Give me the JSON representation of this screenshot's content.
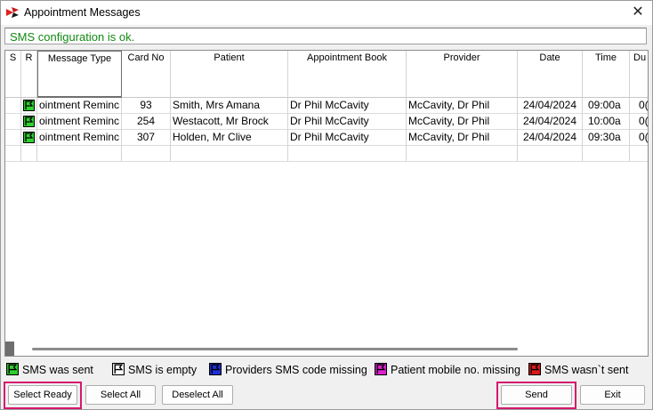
{
  "window": {
    "title": "Appointment Messages",
    "close_glyph": "✕"
  },
  "status": {
    "text": "SMS configuration is ok.",
    "color": "#138a13"
  },
  "grid": {
    "columns": [
      "S",
      "R",
      "Message Type",
      "Card No",
      "Patient",
      "Appointment Book",
      "Provider",
      "Date",
      "Time",
      "Du"
    ],
    "rows": [
      {
        "flag": "green",
        "message_type": "ointment Reminc",
        "card_no": "93",
        "patient": "Smith, Mrs Amana",
        "appointment_book": "Dr Phil McCavity",
        "provider": "McCavity, Dr Phil",
        "date": "24/04/2024",
        "time": "09:00a",
        "duration": "0("
      },
      {
        "flag": "green",
        "message_type": "ointment Reminc",
        "card_no": "254",
        "patient": "Westacott, Mr Brock",
        "appointment_book": "Dr Phil McCavity",
        "provider": "McCavity, Dr Phil",
        "date": "24/04/2024",
        "time": "10:00a",
        "duration": "0("
      },
      {
        "flag": "green",
        "message_type": "ointment Reminc",
        "card_no": "307",
        "patient": "Holden, Mr Clive",
        "appointment_book": "Dr Phil McCavity",
        "provider": "McCavity, Dr Phil",
        "date": "24/04/2024",
        "time": "09:30a",
        "duration": "0("
      }
    ]
  },
  "legend": [
    {
      "icon": "flag-icon",
      "color": "#2fd12f",
      "label": "SMS was sent"
    },
    {
      "icon": "flag-icon",
      "color": "#ffffff",
      "label": "SMS is empty"
    },
    {
      "icon": "flag-icon",
      "color": "#1f2fd8",
      "label": "Providers SMS code missing"
    },
    {
      "icon": "flag-icon",
      "color": "#e020d0",
      "label": "Patient mobile no. missing"
    },
    {
      "icon": "flag-icon",
      "color": "#e01818",
      "label": "SMS wasn`t sent"
    }
  ],
  "buttons": {
    "select_ready": "Select Ready",
    "select_all": "Select All",
    "deselect_all": "Deselect All",
    "send": "Send",
    "exit": "Exit"
  },
  "colors": {
    "highlight": "#d6186e"
  }
}
